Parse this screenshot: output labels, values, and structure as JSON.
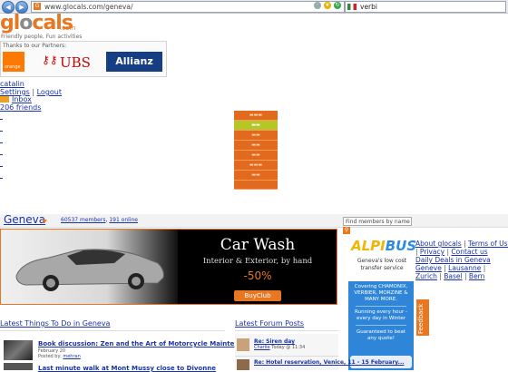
{
  "browser": {
    "back_icon": "arrow-left-icon",
    "forward_icon": "arrow-right-icon",
    "url": "www.glocals.com/geneva/",
    "search_text": "verbi"
  },
  "site": {
    "logo_prefix": "gl",
    "logo_o": "o",
    "logo_suffix": "cals",
    "logo_com": ".com",
    "tagline": "Friendly people, Fun activities"
  },
  "partners": {
    "title": "Thanks to our Partners:",
    "orange": "orange",
    "ubs": "UBS",
    "allianz": "Allianz"
  },
  "user": {
    "name": "catalin",
    "settings": "Settings",
    "sep": "|",
    "logout": "Logout",
    "inbox": "Inbox",
    "friends": "206 friends"
  },
  "community": {
    "city": "Geneva",
    "members": "60537 members",
    "online_sep": ",",
    "online": "191 online",
    "find_placeholder": "Find members by name"
  },
  "banner": {
    "title": "Car Wash",
    "subtitle": "Interior & Exterior, by hand",
    "discount": "-50%",
    "button": "BuyClub"
  },
  "ad": {
    "logo_a": "ALPI",
    "logo_b": "BUS",
    "tagline": "Geneva's low cost transfer service",
    "line1": "Covering CHAMONIX, VERBIER, MORZINE & MANY MORE.",
    "line2": "Running every hour - every day in Winter",
    "line3": "Guaranteed to beat any quote!",
    "feedback": "Feedback"
  },
  "right_links": {
    "about": "About glocals",
    "terms": "Terms of Use",
    "privacy": "Privacy",
    "contact": "Contact us",
    "daily": "Daily Deals in Geneva",
    "geneve": "Geneve",
    "lausanne": "Lausanne",
    "zurich": "Zurich",
    "basel": "Basel",
    "bern": "Bern",
    "sep": "|"
  },
  "things": {
    "heading": "Latest Things To Do in Geneva",
    "item1_title": "Book discussion: Zen and the Art of Motorcycle Mainte",
    "item1_date": "February 20",
    "item1_posted": "Posted by:",
    "item1_author": "mehran",
    "item2_title": "Last minute walk at Mont Mussy close to Divonne"
  },
  "forum": {
    "heading": "Latest Forum Posts",
    "post1_title": "Re: Siren day",
    "post1_author": "Charlie",
    "post1_time": "Today @ 11:34",
    "post2_title": "Re: Hotel reservation, Venice, 11 - 15 February..."
  },
  "colors": {
    "brand_orange": "#e87722",
    "link_blue": "#1a33a8",
    "allianz_blue": "#163e84",
    "ubs_red": "#cc0000",
    "alpibus_blue": "#2f86d8"
  }
}
